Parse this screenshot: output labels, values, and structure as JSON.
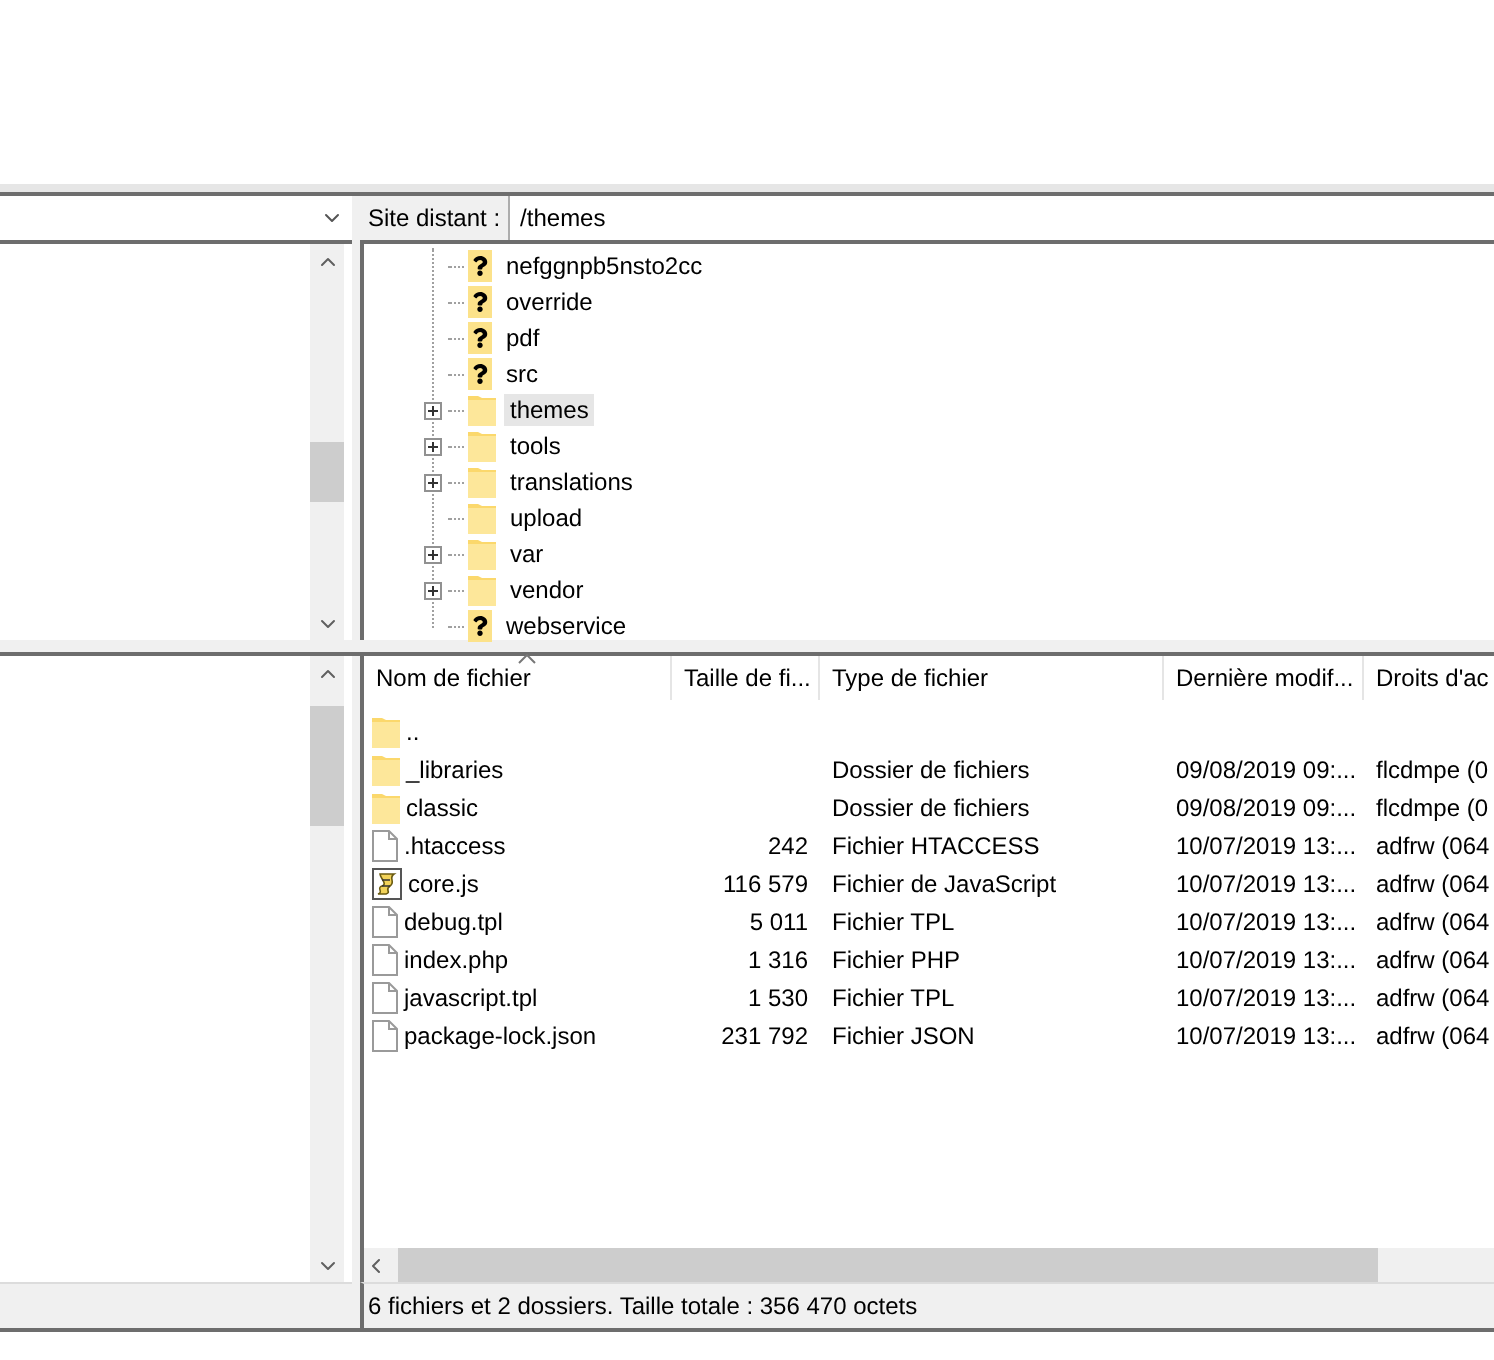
{
  "remote_site": {
    "label": "Site distant :",
    "path": "/themes"
  },
  "remote_tree": [
    {
      "name": "nefggnpb5nsto2cc",
      "kind": "unknown",
      "expandable": false,
      "selected": false
    },
    {
      "name": "override",
      "kind": "unknown",
      "expandable": false,
      "selected": false
    },
    {
      "name": "pdf",
      "kind": "unknown",
      "expandable": false,
      "selected": false
    },
    {
      "name": "src",
      "kind": "unknown",
      "expandable": false,
      "selected": false
    },
    {
      "name": "themes",
      "kind": "folder",
      "expandable": true,
      "selected": true
    },
    {
      "name": "tools",
      "kind": "folder",
      "expandable": true,
      "selected": false
    },
    {
      "name": "translations",
      "kind": "folder",
      "expandable": true,
      "selected": false
    },
    {
      "name": "upload",
      "kind": "folder",
      "expandable": false,
      "selected": false
    },
    {
      "name": "var",
      "kind": "folder",
      "expandable": true,
      "selected": false
    },
    {
      "name": "vendor",
      "kind": "folder",
      "expandable": true,
      "selected": false
    },
    {
      "name": "webservice",
      "kind": "unknown",
      "expandable": false,
      "selected": false
    }
  ],
  "remote_files": {
    "columns": [
      {
        "label": "Nom de fichier",
        "sorted": true
      },
      {
        "label": "Taille de fi...",
        "sorted": false
      },
      {
        "label": "Type de fichier",
        "sorted": false
      },
      {
        "label": "Dernière modif...",
        "sorted": false
      },
      {
        "label": "Droits d'ac",
        "sorted": false
      }
    ],
    "rows": [
      {
        "kind": "folder",
        "name": ".."
      },
      {
        "kind": "folder",
        "name": "_libraries",
        "type": "Dossier de fichiers",
        "modified": "09/08/2019 09:...",
        "permissions": "flcdmpe (0"
      },
      {
        "kind": "folder",
        "name": "classic",
        "type": "Dossier de fichiers",
        "modified": "09/08/2019 09:...",
        "permissions": "flcdmpe (0"
      },
      {
        "kind": "file",
        "name": ".htaccess",
        "size": "242",
        "type": "Fichier HTACCESS",
        "modified": "10/07/2019 13:...",
        "permissions": "adfrw (064"
      },
      {
        "kind": "script",
        "name": "core.js",
        "size": "116 579",
        "type": "Fichier de JavaScript",
        "modified": "10/07/2019 13:...",
        "permissions": "adfrw (064"
      },
      {
        "kind": "file",
        "name": "debug.tpl",
        "size": "5 011",
        "type": "Fichier TPL",
        "modified": "10/07/2019 13:...",
        "permissions": "adfrw (064"
      },
      {
        "kind": "file",
        "name": "index.php",
        "size": "1 316",
        "type": "Fichier PHP",
        "modified": "10/07/2019 13:...",
        "permissions": "adfrw (064"
      },
      {
        "kind": "file",
        "name": "javascript.tpl",
        "size": "1 530",
        "type": "Fichier TPL",
        "modified": "10/07/2019 13:...",
        "permissions": "adfrw (064"
      },
      {
        "kind": "file",
        "name": "package-lock.json",
        "size": "231 792",
        "type": "Fichier JSON",
        "modified": "10/07/2019 13:...",
        "permissions": "adfrw (064"
      }
    ],
    "status": "6 fichiers et 2 dossiers. Taille totale : 356 470 octets"
  }
}
